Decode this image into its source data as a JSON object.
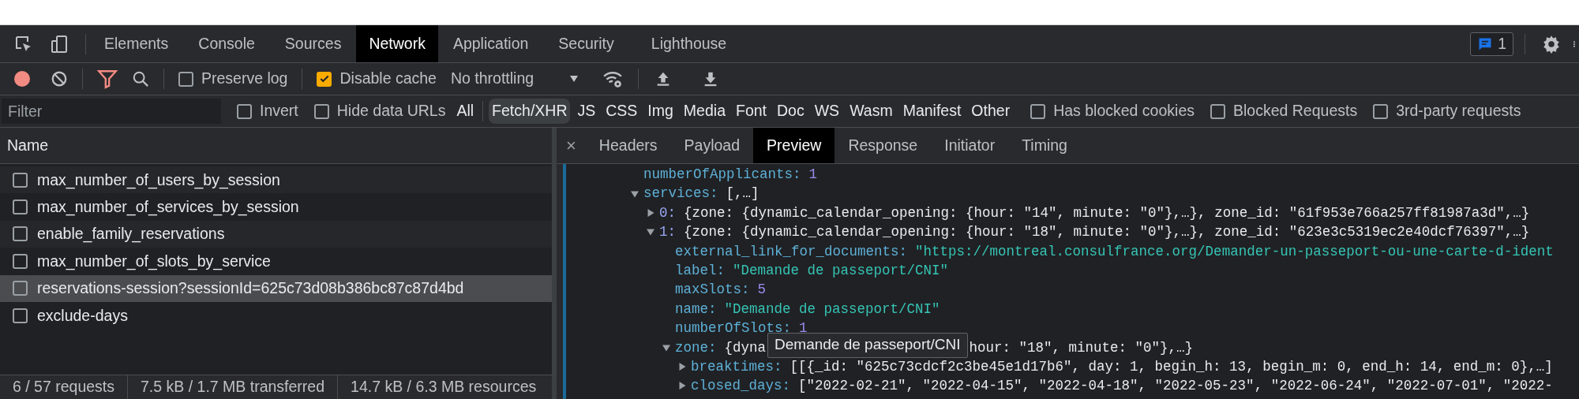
{
  "devtools": {
    "panel_tabs": [
      {
        "label": "Elements",
        "selected": false
      },
      {
        "label": "Console",
        "selected": false
      },
      {
        "label": "Sources",
        "selected": false
      },
      {
        "label": "Network",
        "selected": true
      },
      {
        "label": "Application",
        "selected": false
      },
      {
        "label": "Security",
        "selected": false
      },
      {
        "label": "Lighthouse",
        "selected": false
      }
    ],
    "issues_count": "1"
  },
  "toolbar": {
    "recording": true,
    "preserve_log": {
      "label": "Preserve log",
      "checked": false
    },
    "disable_cache": {
      "label": "Disable cache",
      "checked": true
    },
    "throttling": "No throttling"
  },
  "filter_bar": {
    "placeholder": "Filter",
    "options": [
      {
        "label": "Invert",
        "checked": false
      },
      {
        "label": "Hide data URLs",
        "checked": false
      }
    ],
    "types": [
      {
        "label": "All",
        "selected": false
      },
      {
        "label": "Fetch/XHR",
        "selected": true
      },
      {
        "label": "JS",
        "selected": false
      },
      {
        "label": "CSS",
        "selected": false
      },
      {
        "label": "Img",
        "selected": false
      },
      {
        "label": "Media",
        "selected": false
      },
      {
        "label": "Font",
        "selected": false
      },
      {
        "label": "Doc",
        "selected": false
      },
      {
        "label": "WS",
        "selected": false
      },
      {
        "label": "Wasm",
        "selected": false
      },
      {
        "label": "Manifest",
        "selected": false
      },
      {
        "label": "Other",
        "selected": false
      }
    ],
    "extra_filters": [
      {
        "label": "Has blocked cookies",
        "checked": false
      },
      {
        "label": "Blocked Requests",
        "checked": false
      },
      {
        "label": "3rd-party requests",
        "checked": false
      }
    ]
  },
  "requests": {
    "column": "Name",
    "rows": [
      {
        "name": "max_number_of_users_by_session",
        "checked": false,
        "selected": false
      },
      {
        "name": "max_number_of_services_by_session",
        "checked": false,
        "selected": false
      },
      {
        "name": "enable_family_reservations",
        "checked": false,
        "selected": false
      },
      {
        "name": "max_number_of_slots_by_service",
        "checked": false,
        "selected": false
      },
      {
        "name": "reservations-session?sessionId=625c73d08b386bc87c87d4bd",
        "checked": false,
        "selected": true
      },
      {
        "name": "exclude-days",
        "checked": false,
        "selected": false
      }
    ]
  },
  "status_bar": [
    "6 / 57 requests",
    "7.5 kB / 1.7 MB transferred",
    "14.7 kB / 6.3 MB resources"
  ],
  "detail": {
    "close": "×",
    "tabs": [
      {
        "label": "Headers",
        "selected": false
      },
      {
        "label": "Payload",
        "selected": false
      },
      {
        "label": "Preview",
        "selected": true
      },
      {
        "label": "Response",
        "selected": false
      },
      {
        "label": "Initiator",
        "selected": false
      },
      {
        "label": "Timing",
        "selected": false
      }
    ],
    "preview": {
      "tooltip": "Demande de passeport/CNI",
      "tree": [
        {
          "key": "numberOfApplicants:",
          "value": "1",
          "kind": "number"
        },
        {
          "key": "services:",
          "value": "[,…]",
          "kind": "preview",
          "expanded": true,
          "children": [
            {
              "key": "0:",
              "value": "{zone: {dynamic_calendar_opening: {hour: \"14\", minute: \"0\"},…}, zone_id: \"61f953e766a257ff81987a3d\",…}",
              "kind": "index",
              "expanded": false
            },
            {
              "key": "1:",
              "value": "{zone: {dynamic_calendar_opening: {hour: \"18\", minute: \"0\"},…}, zone_id: \"623e3c5319ec2e40dcf76397\",…}",
              "kind": "index",
              "expanded": true,
              "children": [
                {
                  "key": "external_link_for_documents:",
                  "value": "\"https://montreal.consulfrance.org/Demander-un-passeport-ou-une-carte-d-ident",
                  "kind": "string"
                },
                {
                  "key": "label:",
                  "value": "\"Demande de passeport/CNI\"",
                  "kind": "string"
                },
                {
                  "key": "maxSlots:",
                  "value": "5",
                  "kind": "number"
                },
                {
                  "key": "name:",
                  "value": "\"Demande de passeport/CNI\"",
                  "kind": "string"
                },
                {
                  "key": "numberOfSlots:",
                  "value": "1",
                  "kind": "number"
                },
                {
                  "key": "zone:",
                  "value_parts": [
                    "{dyna",
                    "hour: \"18\", minute: \"0\"},…}"
                  ],
                  "kind": "preview",
                  "expanded": true,
                  "children": [
                    {
                      "key": "breaktimes:",
                      "value": "[[{_id: \"625c73cdcf2c3be45e1d17b6\", day: 1, begin_h: 13, begin_m: 0, end_h: 14, end_m: 0},…]",
                      "kind": "preview",
                      "expanded": false
                    },
                    {
                      "key": "closed_days:",
                      "value": "[\"2022-02-21\", \"2022-04-15\", \"2022-04-18\", \"2022-05-23\", \"2022-06-24\", \"2022-07-01\", \"2022-",
                      "kind": "preview",
                      "expanded": false
                    }
                  ]
                }
              ]
            }
          ]
        }
      ]
    }
  }
}
